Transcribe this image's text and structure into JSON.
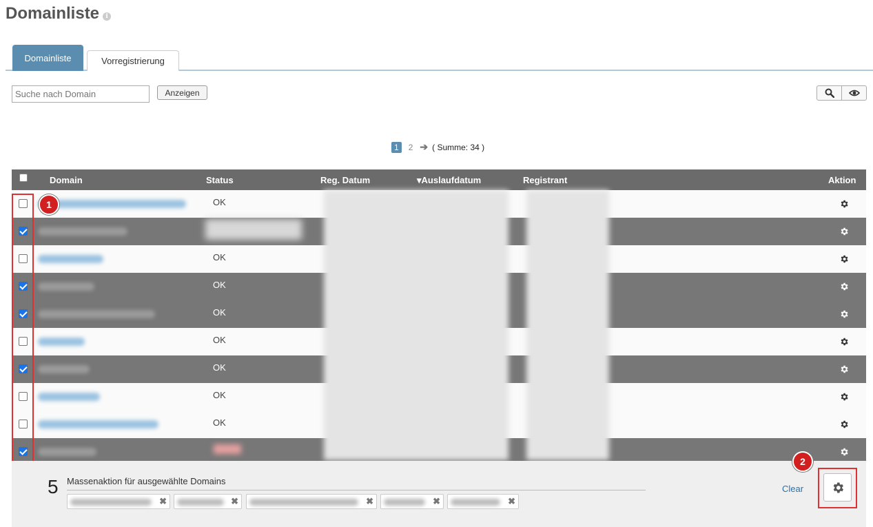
{
  "page": {
    "title": "Domainliste"
  },
  "tabs": [
    {
      "label": "Domainliste",
      "active": true
    },
    {
      "label": "Vorregistrierung",
      "active": false
    }
  ],
  "search": {
    "placeholder": "Suche nach Domain",
    "value": "",
    "button_label": "Anzeigen"
  },
  "toolbar": {
    "icons": [
      "search-icon",
      "eye-icon"
    ]
  },
  "pagination": {
    "current": "1",
    "next": "2",
    "total_label": "( Summe: 34 )"
  },
  "table": {
    "columns": [
      "Domain",
      "Status",
      "Reg. Datum",
      "Auslaufdatum",
      "Registrant",
      "Aktion"
    ],
    "sort_indicator": "▾",
    "rows": [
      {
        "checked": false,
        "status": "OK"
      },
      {
        "checked": true,
        "status": ""
      },
      {
        "checked": false,
        "status": "OK"
      },
      {
        "checked": true,
        "status": "OK"
      },
      {
        "checked": true,
        "status": "OK"
      },
      {
        "checked": false,
        "status": "OK"
      },
      {
        "checked": true,
        "status": "OK"
      },
      {
        "checked": false,
        "status": "OK"
      },
      {
        "checked": false,
        "status": "OK"
      },
      {
        "checked": true,
        "status": ""
      }
    ]
  },
  "badges": {
    "first": "1",
    "second": "2"
  },
  "mass_action": {
    "count": "5",
    "label": "Massenaktion für ausgewählte Domains",
    "clear_label": "Clear",
    "tag_remove_glyph": "✖"
  },
  "colors": {
    "accent": "#5b8db1",
    "header": "#6b6b6b",
    "selected_row": "#777777",
    "highlight": "#e03030",
    "badge": "#d21f1f",
    "link": "#2a6fa8"
  }
}
